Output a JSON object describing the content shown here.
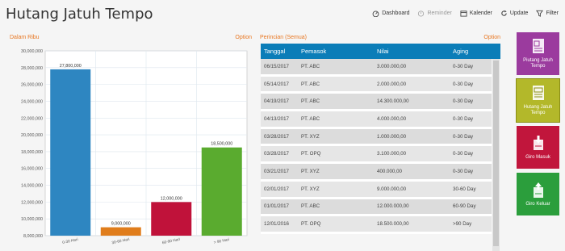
{
  "page": {
    "title": "Hutang Jatuh Tempo"
  },
  "toolbar": {
    "items": [
      {
        "label": "Dashboard",
        "icon": "dashboard-icon",
        "enabled": true
      },
      {
        "label": "Reminder",
        "icon": "alarm-clock-icon",
        "enabled": false
      },
      {
        "label": "Kalender",
        "icon": "calendar-icon",
        "enabled": true
      },
      {
        "label": "Update",
        "icon": "refresh-icon",
        "enabled": true
      },
      {
        "label": "Filter",
        "icon": "filter-icon",
        "enabled": true
      }
    ]
  },
  "chart_panel": {
    "unit_label": "Dalam Ribu",
    "option_label": "Option"
  },
  "table_panel": {
    "title": "Perincian (Semua)",
    "option_label": "Option",
    "columns": [
      "Tanggal",
      "Pemasok",
      "Nilai",
      "Aging"
    ],
    "rows": [
      [
        "06/15/2017",
        "PT. ABC",
        "3.000.000,00",
        "0-30 Day"
      ],
      [
        "05/14/2017",
        "PT. ABC",
        "2.000.000,00",
        "0-30 Day"
      ],
      [
        "04/19/2017",
        "PT. ABC",
        "14.300.000,00",
        "0-30 Day"
      ],
      [
        "04/13/2017",
        "PT. ABC",
        "4.000.000,00",
        "0-30 Day"
      ],
      [
        "03/28/2017",
        "PT. XYZ",
        "1.000.000,00",
        "0-30 Day"
      ],
      [
        "03/28/2017",
        "PT. OPQ",
        "3.100.000,00",
        "0-30 Day"
      ],
      [
        "03/21/2017",
        "PT. XYZ",
        "400.000,00",
        "0-30 Day"
      ],
      [
        "02/01/2017",
        "PT. XYZ",
        "9.000.000,00",
        "30-60 Day"
      ],
      [
        "01/01/2017",
        "PT. ABC",
        "12.000.000,00",
        "60-90 Day"
      ],
      [
        "12/01/2016",
        "PT. OPQ",
        "18.500.000,00",
        ">90 Day"
      ]
    ]
  },
  "tiles": [
    {
      "label": "Piutang Jatuh Tempo",
      "icon": "document-icon",
      "color": "#9b3b9e"
    },
    {
      "label": "Hutang Jatuh Tempo",
      "icon": "document-icon",
      "color": "#b3b82a"
    },
    {
      "label": "Giro Masuk",
      "icon": "giro-in-icon",
      "color": "#c1163c"
    },
    {
      "label": "Giro Keluar",
      "icon": "giro-out-icon",
      "color": "#2b9e3c"
    }
  ],
  "chart_data": {
    "type": "bar",
    "categories": [
      "0-30 Hari",
      "30-60 Hari",
      "60-90 Hari",
      "> 90 Hari"
    ],
    "values": [
      27800000,
      9000000,
      12000000,
      18500000
    ],
    "value_labels": [
      "27,800,000",
      "9,000,000",
      "12,000,000",
      "18,500,000"
    ],
    "colors": [
      "#2e86c1",
      "#e07d1c",
      "#c0123a",
      "#5aab2f"
    ],
    "ylim": [
      8000000,
      30000000
    ],
    "yticks": [
      "8,000,000",
      "10,000,000",
      "12,000,000",
      "14,000,000",
      "16,000,000",
      "18,000,000",
      "20,000,000",
      "22,000,000",
      "24,000,000",
      "26,000,000",
      "28,000,000",
      "30,000,000"
    ],
    "ytick_values": [
      8000000,
      10000000,
      12000000,
      14000000,
      16000000,
      18000000,
      20000000,
      22000000,
      24000000,
      26000000,
      28000000,
      30000000
    ],
    "grid": true
  }
}
